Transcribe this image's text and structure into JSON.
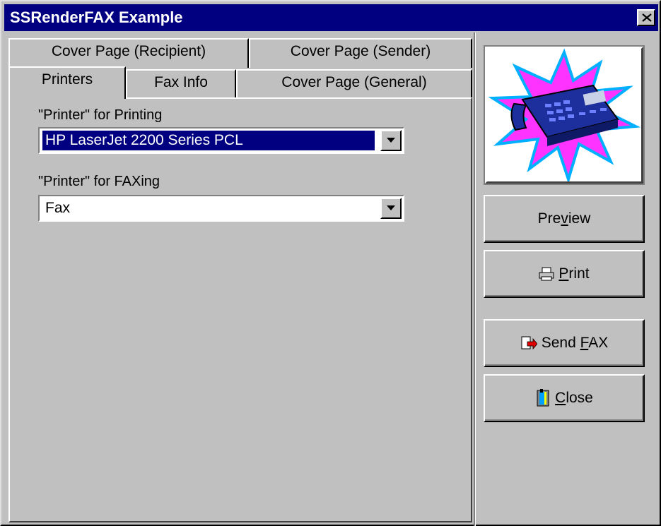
{
  "window": {
    "title": "SSRenderFAX Example",
    "close_label": "close"
  },
  "tabs": {
    "row1": [
      "Cover Page (Recipient)",
      "Cover Page (Sender)"
    ],
    "row2": [
      "Printers",
      "Fax Info",
      "Cover Page (General)"
    ],
    "active": "Printers"
  },
  "printers": {
    "print_label": "\"Printer\" for Printing",
    "print_value": "HP LaserJet 2200 Series PCL",
    "fax_label": "\"Printer\" for FAXing",
    "fax_value": "Fax"
  },
  "buttons": {
    "preview": {
      "pre": "Pre",
      "ul": "v",
      "post": "iew"
    },
    "print": {
      "pre": "",
      "ul": "P",
      "post": "rint"
    },
    "send_fax": {
      "pre": "Send ",
      "ul": "F",
      "post": "AX"
    },
    "close": {
      "pre": "",
      "ul": "C",
      "post": "lose"
    }
  },
  "icons": [
    "fax-machine-image",
    "printer-icon",
    "send-fax-icon",
    "door-exit-icon",
    "close-x-icon",
    "dropdown-arrow-icon"
  ],
  "colors": {
    "titlebar": "#000080",
    "face": "#c0c0c0",
    "selection": "#000080",
    "star": "#ff33ff"
  }
}
